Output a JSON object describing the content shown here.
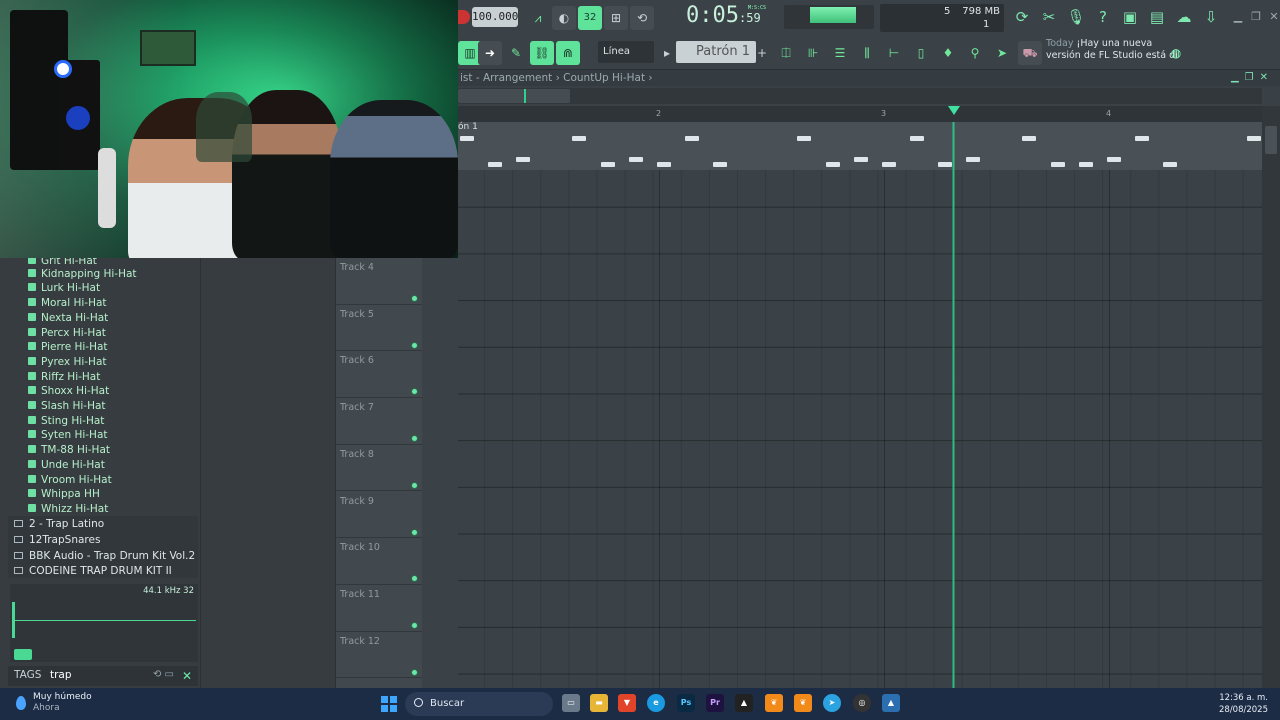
{
  "toolbar": {
    "tempo": "100.000",
    "time_main": "0:05",
    "time_sub": "59",
    "time_label": "M:S:CS",
    "pattern_count": "32",
    "cpu_poly": "5",
    "memory": "798 MB",
    "voices": "1",
    "snap_mode": "Línea",
    "pattern": "Patrón 1",
    "news_today": "Today",
    "news_msg_1": "¡Hay una nueva",
    "news_msg_2": "versión de FL Studio está di"
  },
  "playlist": {
    "breadcrumb": "ist - Arrangement  ›  CountUp Hi-Hat  ›",
    "pattern_lane_label": "ón 1",
    "bar_numbers": [
      "2",
      "3",
      "4"
    ],
    "tracks": [
      "Track 4",
      "Track 5",
      "Track 6",
      "Track 7",
      "Track 8",
      "Track 9",
      "Track 10",
      "Track 11",
      "Track 12"
    ]
  },
  "browser": {
    "items": [
      "Grit Hi-Hat",
      "Kidnapping Hi-Hat",
      "Lurk Hi-Hat",
      "Moral Hi-Hat",
      "Nexta Hi-Hat",
      "Percx Hi-Hat",
      "Pierre Hi-Hat",
      "Pyrex Hi-Hat",
      "Riffz Hi-Hat",
      "Shoxx Hi-Hat",
      "Slash Hi-Hat",
      "Sting Hi-Hat",
      "Syten Hi-Hat",
      "TM-88 Hi-Hat",
      "Unde Hi-Hat",
      "Vroom Hi-Hat",
      "Whippa HH",
      "Whizz Hi-Hat"
    ],
    "folders": [
      "2 - Trap Latino",
      "12TrapSnares",
      "BBK Audio - Trap Drum Kit Vol.2",
      "CODEINE TRAP DRUM KIT II"
    ],
    "sample_info": "44.1 kHz 32",
    "tags_label": "TAGS",
    "tags_value": "trap"
  },
  "taskbar": {
    "weather_title": "Muy húmedo",
    "weather_sub": "Ahora",
    "search_placeholder": "Buscar",
    "time": "12:36 a. m.",
    "date": "28/08/2025"
  },
  "colors": {
    "accent_green": "#2fd28c",
    "panel_dark": "#3b4247",
    "taskbar": "#1d2c45"
  }
}
